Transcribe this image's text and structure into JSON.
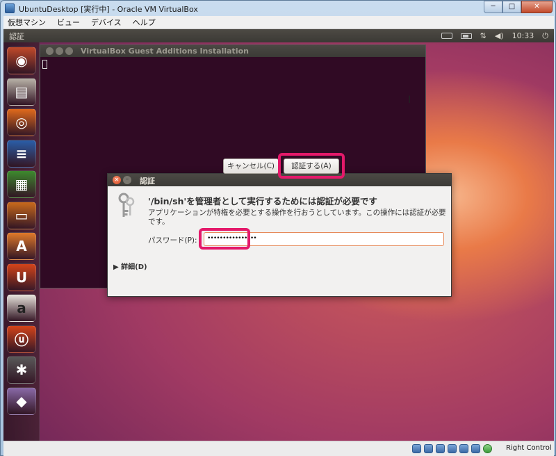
{
  "window": {
    "title": "UbuntuDesktop [実行中] - Oracle VM VirtualBox",
    "minimize": "─",
    "maximize": "□",
    "close": "✕"
  },
  "vbox_menu": [
    "仮想マシン",
    "ビュー",
    "デバイス",
    "ヘルプ"
  ],
  "top_panel": {
    "app_title": "認証",
    "clock": "10:33",
    "icons": [
      "keyboard-icon",
      "battery-icon",
      "network-icon",
      "volume-icon",
      "power-icon"
    ],
    "network_glyph": "⇅",
    "volume_glyph": "◀)",
    "power_glyph": "⏻"
  },
  "launcher": {
    "items": [
      {
        "name": "dash-home",
        "icon": "ubuntu-logo-icon",
        "glyph": "◉",
        "color": "#c14a2a"
      },
      {
        "name": "files",
        "icon": "file-cabinet-icon",
        "glyph": "▤",
        "color": "#b9b3a8"
      },
      {
        "name": "firefox",
        "icon": "firefox-icon",
        "glyph": "◎",
        "color": "#e06a1c"
      },
      {
        "name": "libreoffice-writer",
        "icon": "writer-icon",
        "glyph": "≡",
        "color": "#2a5ea8"
      },
      {
        "name": "libreoffice-calc",
        "icon": "calc-icon",
        "glyph": "▦",
        "color": "#3d8a2e"
      },
      {
        "name": "libreoffice-impress",
        "icon": "impress-icon",
        "glyph": "▭",
        "color": "#c96a1c"
      },
      {
        "name": "software-center",
        "icon": "software-center-icon",
        "glyph": "A",
        "color": "#e07a2a"
      },
      {
        "name": "ubuntu-one",
        "icon": "ubuntu-one-icon",
        "glyph": "U",
        "color": "#d4441a"
      },
      {
        "name": "amazon",
        "icon": "amazon-icon",
        "glyph": "a",
        "color": "#e8e4dc"
      },
      {
        "name": "ubuntu-one-music",
        "icon": "ubuntu-one-music-icon",
        "glyph": "ⓤ",
        "color": "#d4441a"
      },
      {
        "name": "system-settings",
        "icon": "settings-icon",
        "glyph": "✱",
        "color": "#5a5a5a"
      },
      {
        "name": "workspace-switcher",
        "icon": "workspace-icon",
        "glyph": "◆",
        "color": "#8a6aa8"
      }
    ]
  },
  "terminal": {
    "title": "VirtualBox Guest Additions Installation"
  },
  "dialog": {
    "title": "認証",
    "heading": "'/bin/sh'を管理者として実行するためには認証が必要です",
    "description": "アプリケーションが特権を必要とする操作を行おうとしています。この操作には認証が必要です。",
    "password_label": "パスワード(P):",
    "password_value": "••••••••••••••••",
    "details_label": "▶ 詳細(D)",
    "cancel_label": "キャンセル(C)",
    "authenticate_label": "認証する(A)"
  },
  "statusbar": {
    "host_key": "Right Control",
    "icons": [
      "hard-disk-icon",
      "optical-drive-icon",
      "usb-icon",
      "network-adapter-icon",
      "shared-folder-icon",
      "display-icon",
      "mouse-integration-icon"
    ]
  },
  "colors": {
    "highlight": "#e4196a",
    "terminal_bg": "#300a24"
  }
}
